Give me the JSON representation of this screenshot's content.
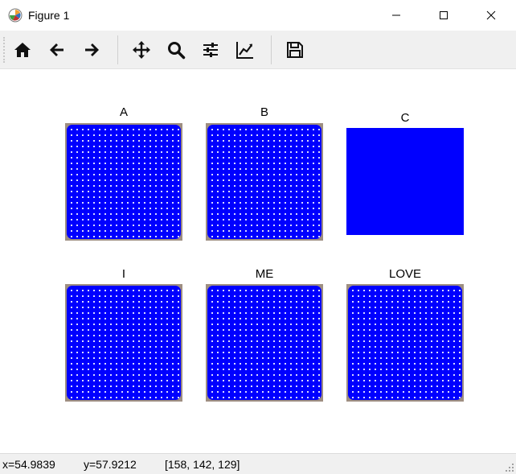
{
  "window": {
    "title": "Figure 1"
  },
  "toolbar": {
    "buttons": [
      {
        "icon": "home-icon"
      },
      {
        "icon": "back-arrow-icon"
      },
      {
        "icon": "forward-arrow-icon"
      },
      {
        "icon": "pan-icon"
      },
      {
        "icon": "zoom-icon"
      },
      {
        "icon": "configure-subplots-icon"
      },
      {
        "icon": "edit-axis-icon"
      },
      {
        "icon": "save-icon"
      }
    ]
  },
  "figure": {
    "panels": [
      {
        "title": "A",
        "style": "image"
      },
      {
        "title": "B",
        "style": "image"
      },
      {
        "title": "C",
        "style": "solid"
      },
      {
        "title": "I",
        "style": "image"
      },
      {
        "title": "ME",
        "style": "image"
      },
      {
        "title": "LOVE",
        "style": "image"
      }
    ],
    "colors": {
      "fill": "#0000ff",
      "border": "#9e8e81",
      "dot": "#ffffff"
    }
  },
  "status": {
    "x": "x=54.9839",
    "y": "y=57.9212",
    "pixel": "[158, 142, 129]"
  }
}
